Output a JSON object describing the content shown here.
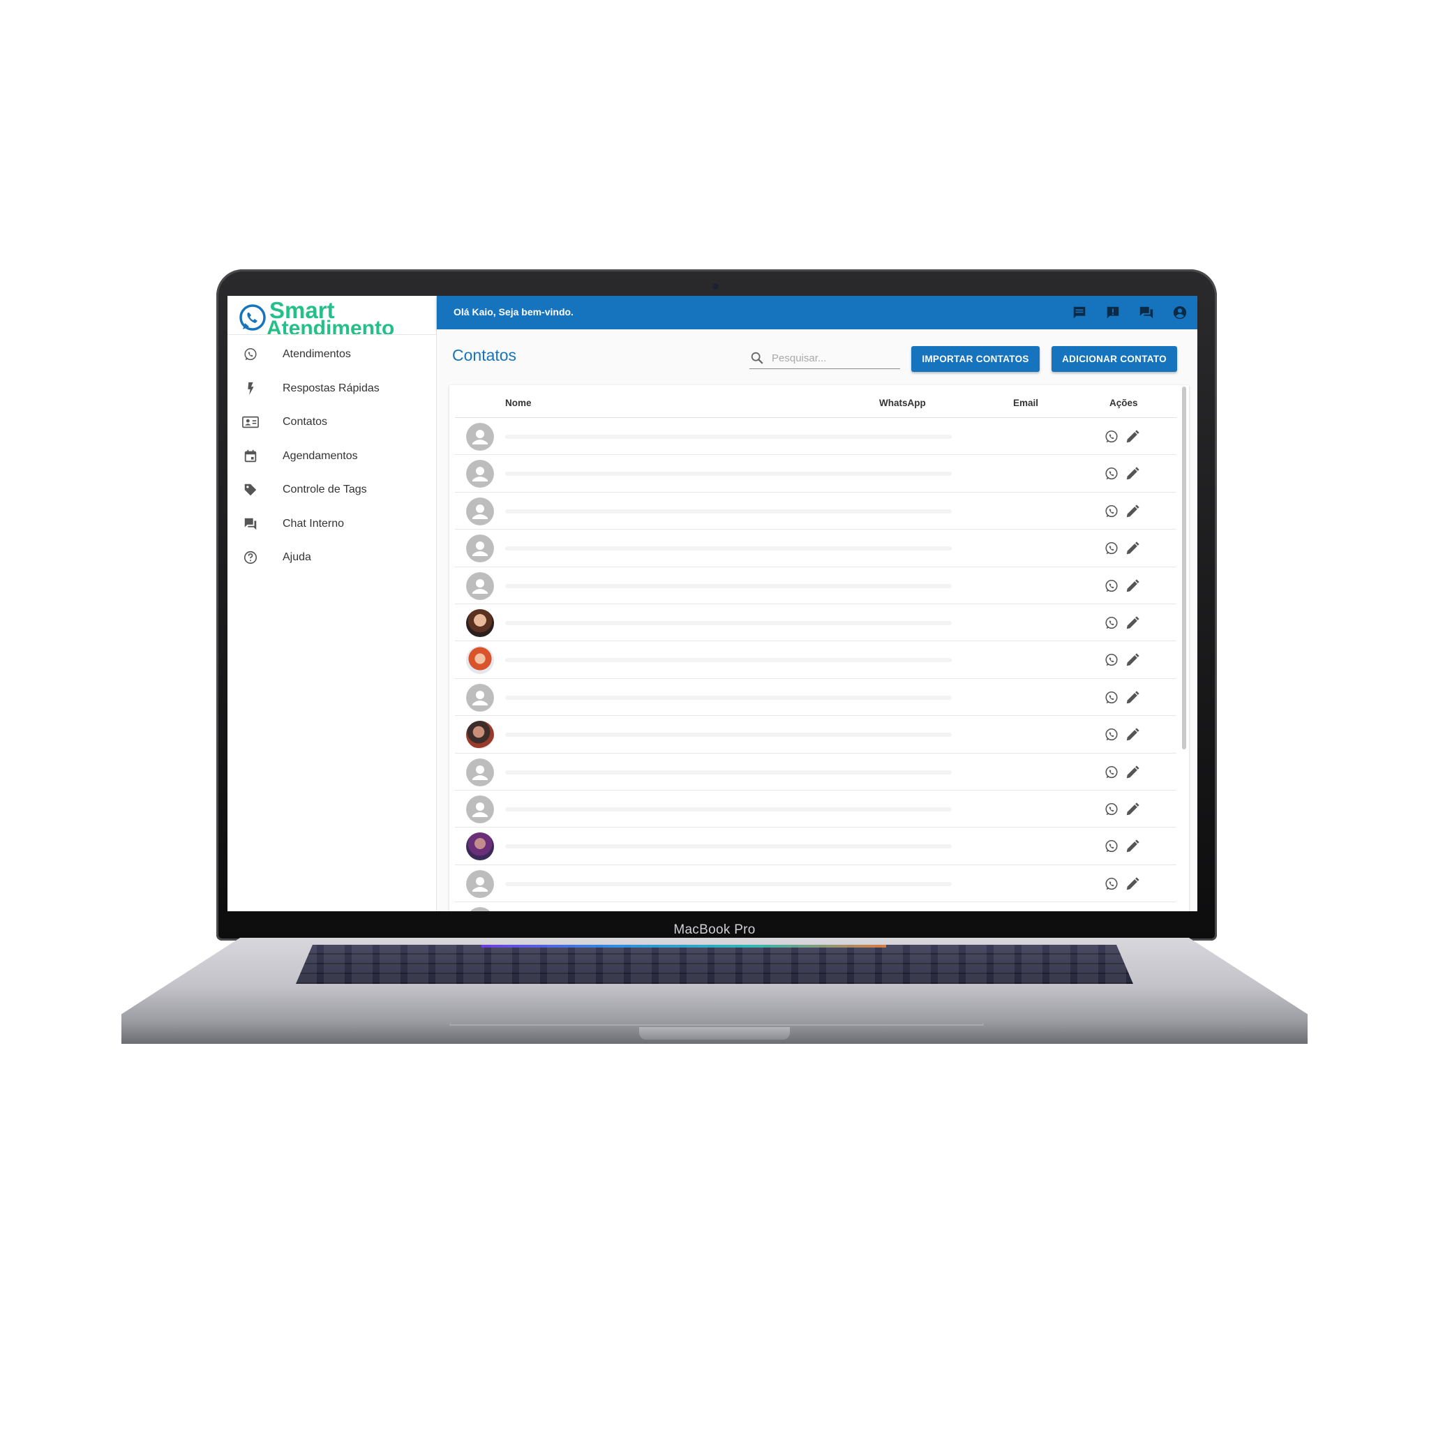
{
  "device": {
    "label": "MacBook Pro"
  },
  "brand": {
    "line1": "Smart",
    "line2": "Atendimento",
    "accent": "#25c08a",
    "primary": "#1674be"
  },
  "sidebar": {
    "items": [
      {
        "label": "Atendimentos",
        "icon": "whatsapp-icon"
      },
      {
        "label": "Respostas Rápidas",
        "icon": "bolt-icon"
      },
      {
        "label": "Contatos",
        "icon": "contact-card-icon"
      },
      {
        "label": "Agendamentos",
        "icon": "calendar-icon"
      },
      {
        "label": "Controle de Tags",
        "icon": "tag-icon"
      },
      {
        "label": "Chat Interno",
        "icon": "forum-icon"
      },
      {
        "label": "Ajuda",
        "icon": "help-circle-icon"
      }
    ]
  },
  "topbar": {
    "greeting": "Olá Kaio, Seja bem-vindo.",
    "icons": [
      "chat-icon",
      "feedback-icon",
      "forum-icon",
      "account-circle-icon"
    ]
  },
  "page": {
    "title": "Contatos",
    "search_placeholder": "Pesquisar...",
    "import_button": "IMPORTAR CONTATOS",
    "add_button": "ADICIONAR CONTATO"
  },
  "table": {
    "columns": [
      "Nome",
      "WhatsApp",
      "Email",
      "Ações"
    ],
    "rows": [
      {
        "avatar": "default"
      },
      {
        "avatar": "default"
      },
      {
        "avatar": "default"
      },
      {
        "avatar": "default"
      },
      {
        "avatar": "default"
      },
      {
        "avatar": "photo"
      },
      {
        "avatar": "photo"
      },
      {
        "avatar": "default"
      },
      {
        "avatar": "photo"
      },
      {
        "avatar": "default"
      },
      {
        "avatar": "default"
      },
      {
        "avatar": "photo"
      },
      {
        "avatar": "default"
      },
      {
        "avatar": "default"
      }
    ],
    "row_actions": [
      "whatsapp-icon",
      "edit-pencil-icon"
    ]
  }
}
